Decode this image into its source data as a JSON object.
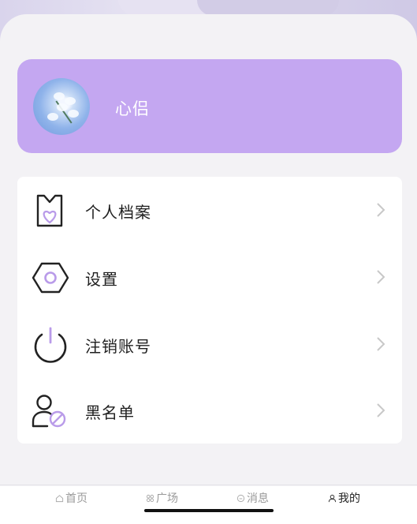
{
  "profile": {
    "username": "心侣"
  },
  "menu": {
    "items": [
      {
        "label": "个人档案",
        "icon": "profile-file-icon"
      },
      {
        "label": "设置",
        "icon": "hexagon-settings-icon"
      },
      {
        "label": "注销账号",
        "icon": "power-icon"
      },
      {
        "label": "黑名单",
        "icon": "user-blocked-icon"
      }
    ]
  },
  "tabbar": {
    "tabs": [
      {
        "label": "首页",
        "icon": "home-icon"
      },
      {
        "label": "广场",
        "icon": "grid-icon"
      },
      {
        "label": "消息",
        "icon": "message-icon"
      },
      {
        "label": "我的",
        "icon": "person-icon"
      }
    ],
    "active": "我的"
  },
  "colors": {
    "accent": "#c4a7f1",
    "icon_accent": "#b99be9",
    "background": "#f3f2f5"
  }
}
